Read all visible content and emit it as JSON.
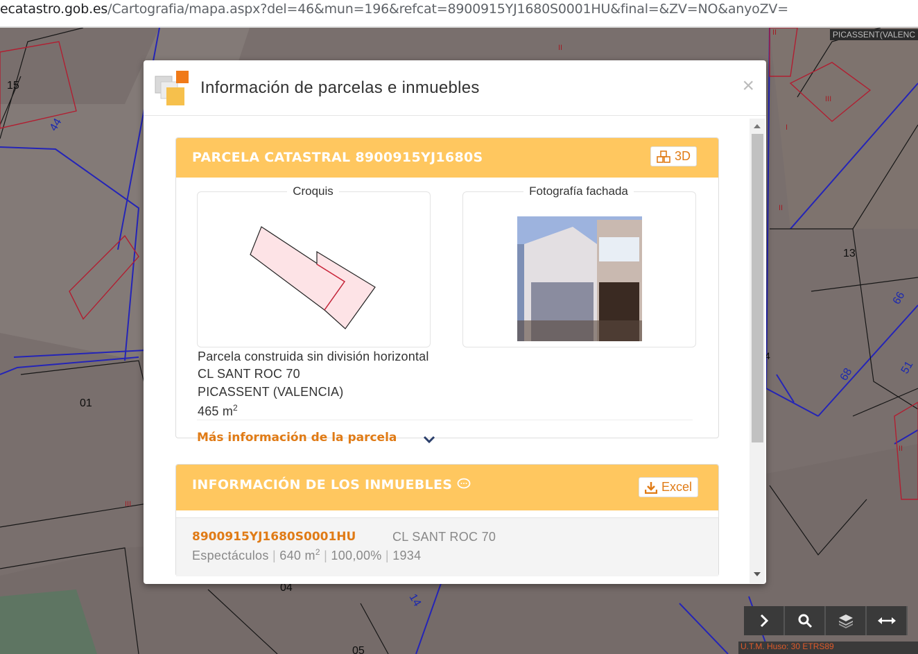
{
  "browser": {
    "url_host": "ecatastro.gob.es",
    "url_path": "/Cartografia/mapa.aspx?del=46&mun=196&refcat=8900915YJ1680S0001HU&final=&ZV=NO&anyoZV="
  },
  "map": {
    "municipality_label": "PICASSENT(VALENC",
    "parcel_labels": [
      "15",
      "44",
      "13",
      "66",
      "68",
      "51",
      "01",
      "04",
      "14",
      "05"
    ],
    "floor_marks": [
      "II",
      "III",
      "I",
      "II",
      "III",
      "II",
      "II",
      "III",
      "II",
      "III",
      "4"
    ],
    "utm_label": "U.T.M. Huso: 30 ETRS89"
  },
  "modal": {
    "title": "Información de parcelas e inmuebles",
    "close_label": "×",
    "parcel_panel": {
      "title": "PARCELA CATASTRAL 8900915YJ1680S",
      "btn_3d_label": "3D",
      "croquis_label": "Croquis",
      "foto_label": "Fotografía fachada",
      "type": "Parcela construida sin división horizontal",
      "address": "CL SANT ROC 70",
      "locality": "PICASSENT (VALENCIA)",
      "area_value": "465 m",
      "area_exp": "2",
      "more_info": "Más información de la parcela"
    },
    "inmuebles_panel": {
      "title": "INFORMACIÓN DE LOS INMUEBLES",
      "excel_label": "Excel",
      "rows": [
        {
          "ref": "8900915YJ1680S0001HU",
          "address": "CL SANT ROC 70",
          "use": "Espectáculos",
          "area": "640 m",
          "area_exp": "2",
          "share": "100,00%",
          "year": "1934"
        }
      ]
    }
  },
  "colors": {
    "panel_header": "#ffc75f",
    "link": "#e07b16",
    "map_bg": "#8f8380",
    "parcel_line": "#2b2bd8",
    "building_line": "#d0243a"
  },
  "toolbar": {
    "icons": [
      "chevron-right-icon",
      "search-icon",
      "layers-icon",
      "arrows-horizontal-icon"
    ]
  }
}
